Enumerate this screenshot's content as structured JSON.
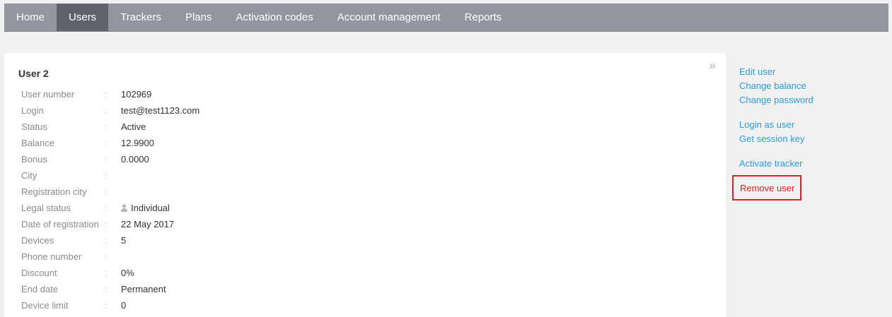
{
  "nav": {
    "items": [
      {
        "label": "Home"
      },
      {
        "label": "Users"
      },
      {
        "label": "Trackers"
      },
      {
        "label": "Plans"
      },
      {
        "label": "Activation codes"
      },
      {
        "label": "Account management"
      },
      {
        "label": "Reports"
      }
    ],
    "active": "Users"
  },
  "user": {
    "title": "User 2",
    "separator": ":",
    "fields": [
      {
        "label": "User number",
        "value": "102969"
      },
      {
        "label": "Login",
        "value": "test@test1123.com"
      },
      {
        "label": "Status",
        "value": "Active"
      },
      {
        "label": "Balance",
        "value": "12.9900"
      },
      {
        "label": "Bonus",
        "value": "0.0000"
      },
      {
        "label": "City",
        "value": ""
      },
      {
        "label": "Registration city",
        "value": ""
      },
      {
        "label": "Legal status",
        "value": "Individual",
        "icon": "person-icon"
      },
      {
        "label": "Date of registration",
        "value": "22 May 2017"
      },
      {
        "label": "Devices",
        "value": "5"
      },
      {
        "label": "Phone number",
        "value": ""
      },
      {
        "label": "Discount",
        "value": "0%"
      },
      {
        "label": "End date",
        "value": "Permanent"
      },
      {
        "label": "Device limit",
        "value": "0"
      }
    ]
  },
  "panel": {
    "expand_icon": "»"
  },
  "actions": {
    "edit_user": "Edit user",
    "change_balance": "Change balance",
    "change_password": "Change password",
    "login_as_user": "Login as user",
    "get_session_key": "Get session key",
    "activate_tracker": "Activate tracker",
    "remove_user": "Remove user"
  },
  "colors": {
    "nav_bg": "#94969f",
    "nav_active": "#5f626d",
    "link": "#2a9bd8",
    "danger": "#dd2222"
  }
}
